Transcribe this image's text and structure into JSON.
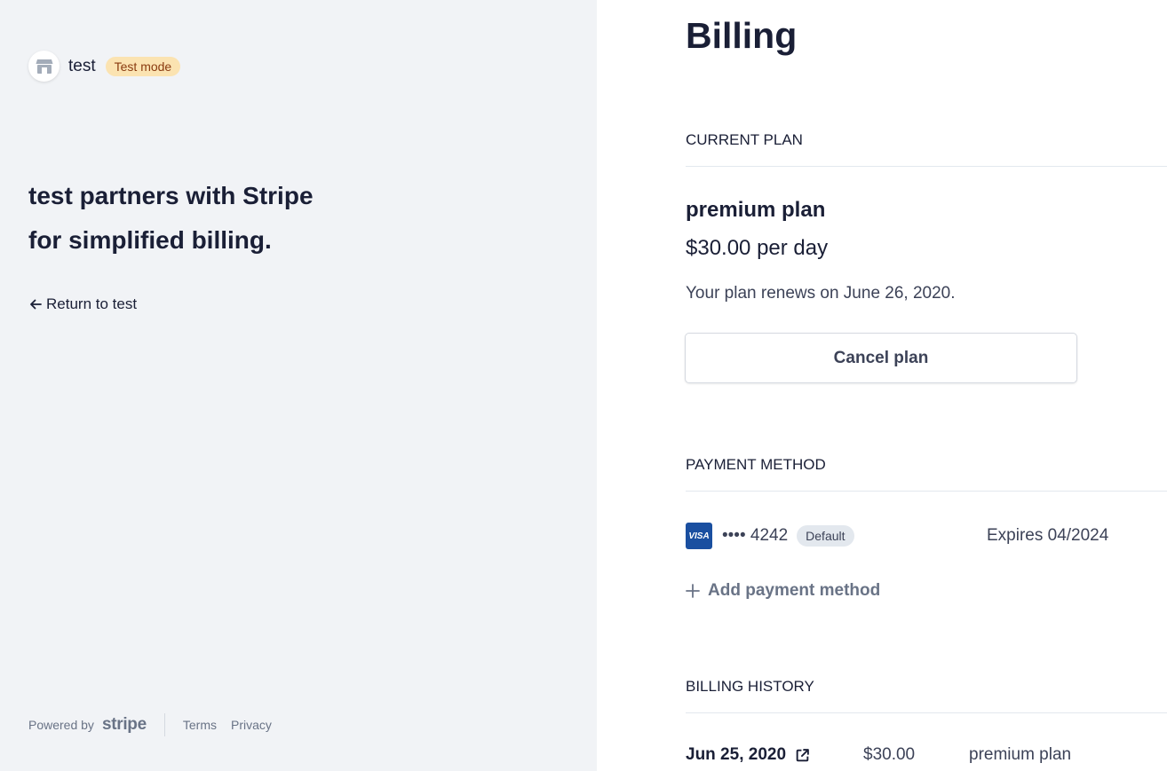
{
  "sidebar": {
    "business_name": "test",
    "mode_badge": "Test mode",
    "tagline": "test partners with Stripe for simplified billing.",
    "return_link": "Return to test",
    "footer": {
      "powered_by": "Powered by",
      "stripe_word": "stripe",
      "terms": "Terms",
      "privacy": "Privacy"
    }
  },
  "main": {
    "title": "Billing",
    "current_plan": {
      "heading": "CURRENT PLAN",
      "plan_name": "premium plan",
      "price": "$30.00 per day",
      "renewal": "Your plan renews on June 26, 2020.",
      "cancel_label": "Cancel plan"
    },
    "payment_method": {
      "heading": "PAYMENT METHOD",
      "card_brand": "VISA",
      "card_number": "•••• 4242",
      "default_badge": "Default",
      "expires": "Expires 04/2024",
      "add_label": "Add payment method"
    },
    "billing_history": {
      "heading": "BILLING HISTORY",
      "rows": [
        {
          "date": "Jun 25, 2020",
          "amount": "$30.00",
          "plan": "premium plan"
        }
      ]
    }
  },
  "colors": {
    "sidebar_bg": "#f1f3f6",
    "text_primary": "#1a1f36",
    "text_muted": "#697386",
    "test_badge_bg": "#fbe3b1",
    "visa_blue": "#1a4fa0"
  }
}
